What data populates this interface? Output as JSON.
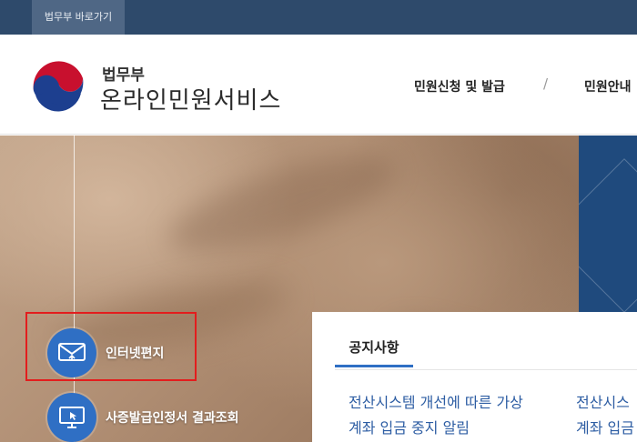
{
  "topbar": {
    "shortcut_label": "법무부 바로가기"
  },
  "header": {
    "brand_sub": "법무부",
    "brand_main": "온라인민원서비스",
    "nav": [
      {
        "label": "민원신청 및 발급"
      },
      {
        "label": "민원안내"
      }
    ],
    "nav_separator": "/"
  },
  "quick_menu": [
    {
      "label": "인터넷편지",
      "icon": "envelope-icon"
    },
    {
      "label": "사증발급인정서 결과조회",
      "icon": "monitor-cursor-icon"
    }
  ],
  "notice": {
    "tab_label": "공지사항",
    "items": [
      {
        "line1": "전산시스템 개선에 따른 가상",
        "line2": "계좌 입금 중지 알림"
      },
      {
        "line1": "전산시스",
        "line2": "계좌 입금"
      }
    ]
  },
  "colors": {
    "topbar": "#2e4a6b",
    "accent_blue": "#2f6fc4",
    "notice_link": "#2d5da3",
    "highlight_red": "#e31d1d"
  }
}
